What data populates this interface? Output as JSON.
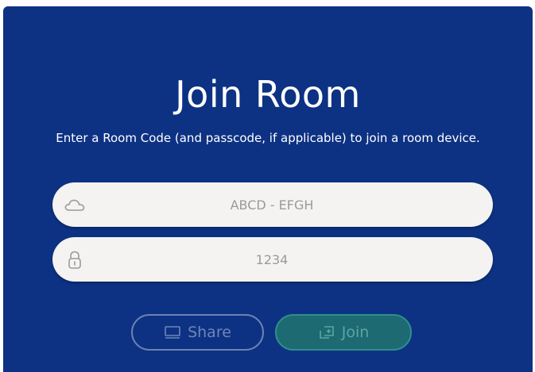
{
  "dialog": {
    "title": "Join Room",
    "subtitle": "Enter a Room Code (and passcode, if applicable) to join a room device."
  },
  "room_code": {
    "placeholder": "ABCD - EFGH",
    "value": "",
    "icon": "cloud-icon"
  },
  "passcode": {
    "placeholder": "1234",
    "value": "",
    "icon": "lock-icon"
  },
  "buttons": {
    "share_label": "Share",
    "share_icon": "monitor-icon",
    "join_label": "Join",
    "join_icon": "join-screen-icon"
  },
  "colors": {
    "background": "#0d3283",
    "field": "#f4f3f1",
    "join_button": "#1d6a73",
    "join_border": "#2f8f8a",
    "share_border": "#6b82b2"
  }
}
